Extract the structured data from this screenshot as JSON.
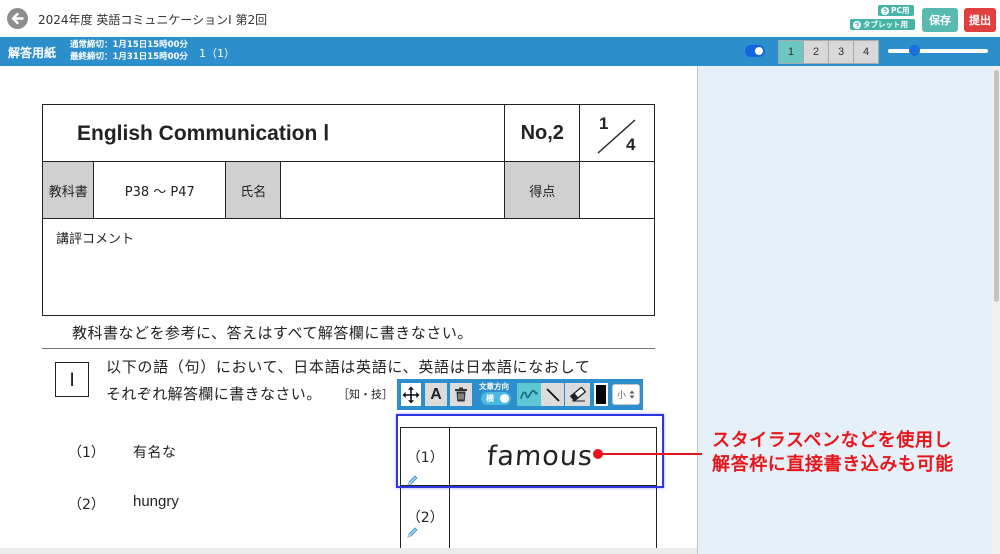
{
  "header": {
    "title": "2024年度 英語コミュニケーションⅠ 第2回",
    "help_pc_label": "PC用",
    "help_tablet_label": "タブレット用",
    "save_label": "保存",
    "submit_label": "提出"
  },
  "subbar": {
    "sheet_label": "解答用紙",
    "deadline_normal": "通常締切：1月15日15時00分",
    "deadline_final": "最終締切：1月31日15時00分",
    "page_indicator": "1（1）",
    "display_toggle_on": true,
    "pages": [
      "1",
      "2",
      "3",
      "4"
    ],
    "active_page": "1",
    "zoom_level": 0.26
  },
  "sheet": {
    "title": "English Communication Ⅰ",
    "number": "No,2",
    "page_numerator": "1",
    "page_denominator": "4",
    "textbook_label": "教科書",
    "textbook_pages": "P38 ～ P47",
    "name_label": "氏名",
    "score_label": "得点",
    "comment_label": "講評コメント",
    "instruction": "教科書などを参考に、答えはすべて解答欄に書きなさい。",
    "section_number": "Ⅰ",
    "question_line1": "以下の語（句）において、日本語は英語に、英語は日本語になおして",
    "question_line2": "それぞれ解答欄に書きなさい。",
    "question_tag": "［知・技］",
    "items": [
      {
        "number": "（1）",
        "prompt": "有名な"
      },
      {
        "number": "（2）",
        "prompt": "hungry"
      }
    ]
  },
  "answer_area": {
    "rows": [
      {
        "number": "（1）",
        "handwriting": "famous"
      },
      {
        "number": "（2）"
      }
    ]
  },
  "toolbar": {
    "text_tool_label": "A",
    "direction_label": "文章方向",
    "direction_value": "横",
    "direction_toggle_on": true,
    "active_tool": "pen",
    "pen_color": "#000000",
    "size_value": "小"
  },
  "callout": {
    "line1": "スタイラスペンなどを使用し",
    "line2": "解答枠に直接書き込みも可能"
  },
  "icons": [
    "arrow-left-icon",
    "help-icon",
    "move-icon",
    "trash-icon",
    "pen-icon",
    "line-icon",
    "eraser-icon",
    "pencil-icon",
    "select-caret-icon"
  ],
  "colors": {
    "primary_blue": "#2c8fcc",
    "save_button": "#58b9b1",
    "submit_button": "#df3f3d",
    "help_badge": "#46b3a8",
    "active_page_tab": "#6cc6c2",
    "active_tool": "#5cc8d3",
    "selection_frame": "#2c37e4",
    "callout_red": "#e8161b",
    "side_panel": "#e6f0f9"
  }
}
